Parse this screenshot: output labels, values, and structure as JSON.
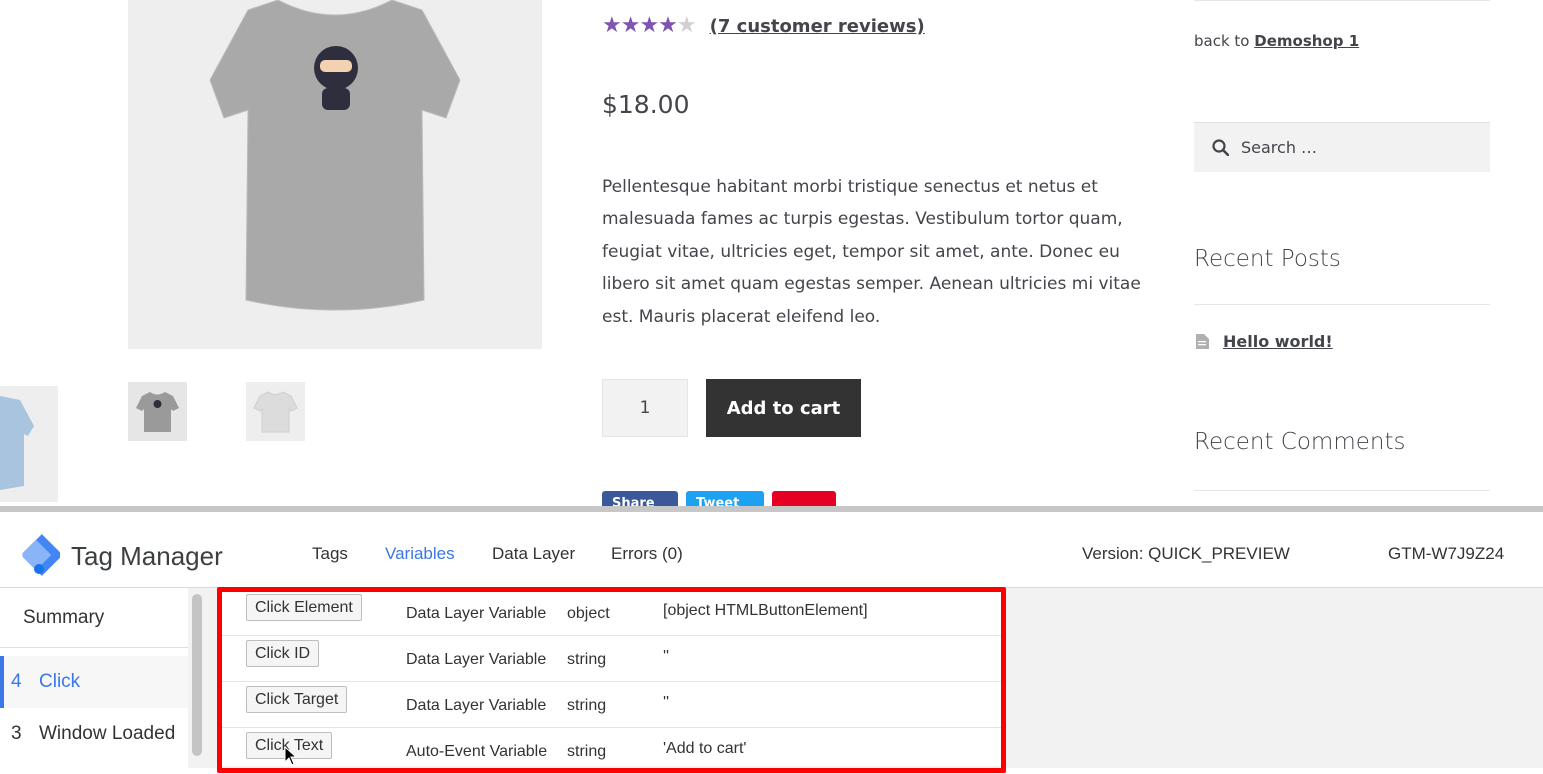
{
  "product": {
    "review_link": "(7 customer reviews)",
    "price": "$18.00",
    "description": "Pellentesque habitant morbi tristique senectus et netus et malesuada fames ac turpis egestas. Vestibulum tortor quam, feugiat vitae, ultricies eget, tempor sit amet, ante. Donec eu libero sit amet quam egestas semper. Aenean ultricies mi vitae est. Mauris placerat eleifend leo.",
    "quantity": "1",
    "add_to_cart": "Add to cart",
    "share_buttons": [
      "Share",
      "Tweet",
      ""
    ],
    "share_colors": [
      "#3b5998",
      "#1da1f2",
      "#e60023"
    ],
    "star_color": "#7f54b3"
  },
  "sidebar": {
    "back_prefix": "back to",
    "back_link": "Demoshop 1",
    "search_placeholder": "Search …",
    "recent_posts_title": "Recent Posts",
    "recent_post": "Hello world!",
    "recent_comments_title": "Recent Comments"
  },
  "gtm": {
    "title": "Tag Manager",
    "tabs": [
      "Tags",
      "Variables",
      "Data Layer",
      "Errors (0)"
    ],
    "active_tab": "Variables",
    "version": "Version: QUICK_PREVIEW",
    "container_id": "GTM-W7J9Z24",
    "accent_color": "#3b78e7",
    "nav": {
      "summary": "Summary",
      "items": [
        {
          "num": "4",
          "label": "Click",
          "active": true
        },
        {
          "num": "3",
          "label": "Window Loaded",
          "active": false
        }
      ]
    },
    "variables": [
      {
        "name": "Click Element",
        "type": "Data Layer Variable",
        "data_type": "object",
        "value": "[object HTMLButtonElement]"
      },
      {
        "name": "Click ID",
        "type": "Data Layer Variable",
        "data_type": "string",
        "value": "''"
      },
      {
        "name": "Click Target",
        "type": "Data Layer Variable",
        "data_type": "string",
        "value": "''"
      },
      {
        "name": "Click Text",
        "type": "Auto-Event Variable",
        "data_type": "string",
        "value": "'Add to cart'"
      }
    ],
    "highlight_color": "#ff0000"
  }
}
